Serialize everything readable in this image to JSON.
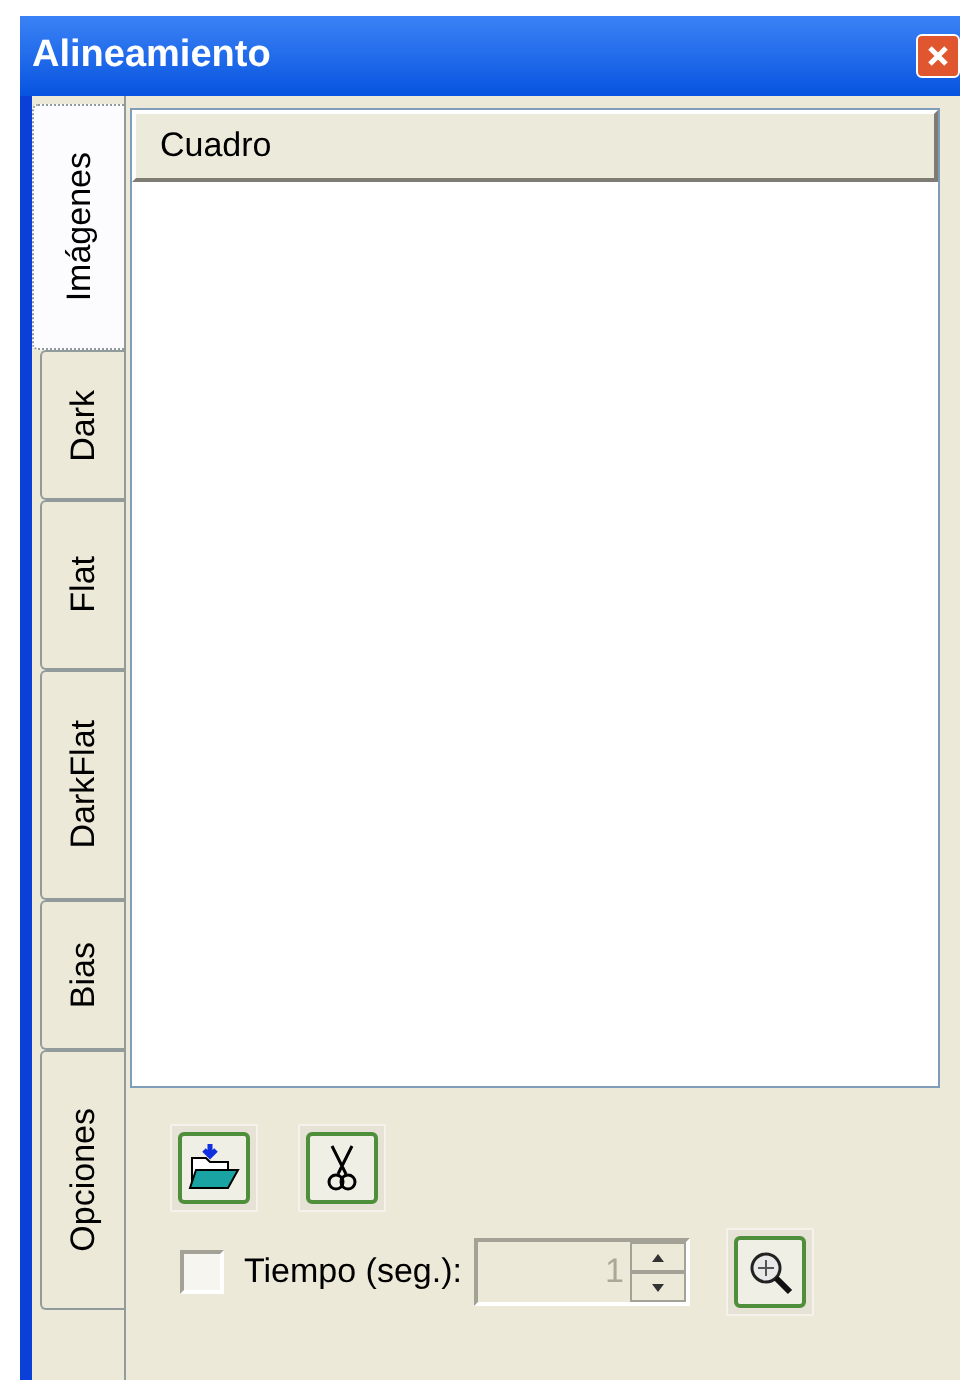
{
  "window": {
    "title": "Alineamiento"
  },
  "tabs": [
    {
      "label": "Imágenes",
      "selected": true
    },
    {
      "label": "Dark",
      "selected": false
    },
    {
      "label": "Flat",
      "selected": false
    },
    {
      "label": "DarkFlat",
      "selected": false
    },
    {
      "label": "Bias",
      "selected": false
    },
    {
      "label": "Opciones",
      "selected": false
    }
  ],
  "list": {
    "columns": [
      "Cuadro"
    ]
  },
  "timer": {
    "label": "Tiempo (seg.):",
    "checked": false,
    "value": "1",
    "disabled": true
  }
}
